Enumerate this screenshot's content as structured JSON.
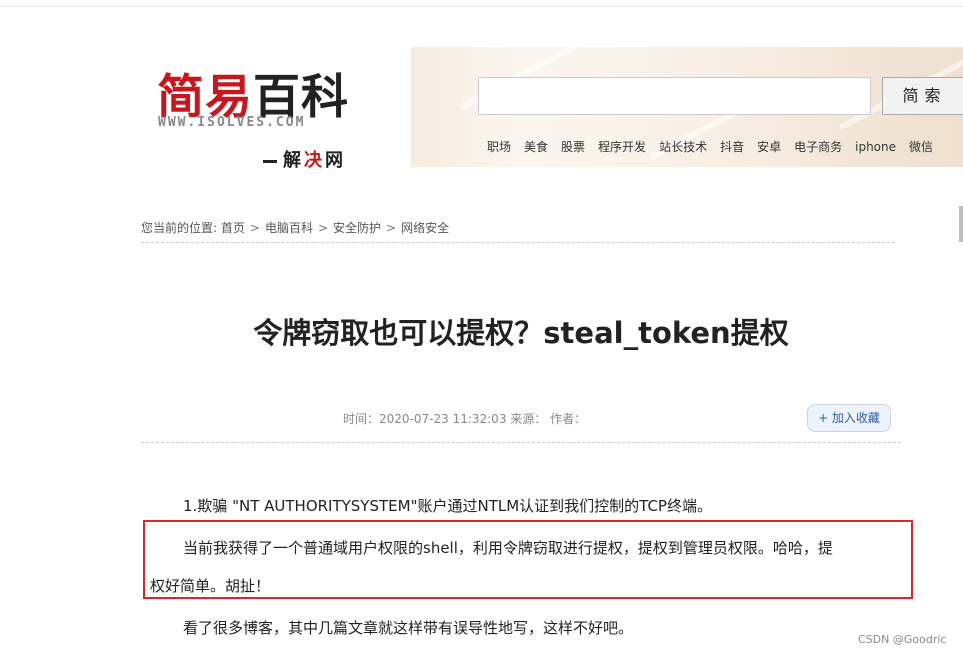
{
  "logo": {
    "title_red": "简易",
    "title_black": "百科",
    "url": "WWW.ISOLVES.COM",
    "slogan_a": "解",
    "slogan_b": "决",
    "slogan_c": "网"
  },
  "search": {
    "value": "",
    "placeholder": "",
    "button_label": "简索"
  },
  "hot_links": [
    "职场",
    "美食",
    "股票",
    "程序开发",
    "站长技术",
    "抖音",
    "安卓",
    "电子商务",
    "iphone",
    "微信"
  ],
  "breadcrumb": {
    "prefix": "您当前的位置:",
    "items": [
      "首页",
      "电脑百科",
      "安全防护",
      "网络安全"
    ],
    "separator": ">"
  },
  "article": {
    "title": "令牌窃取也可以提权？steal_token提权",
    "meta": "时间：2020-07-23 11:32:03  来源：  作者：",
    "favorite_label": "+ 加入收藏",
    "paragraphs": [
      "1.欺骗 \"NT AUTHORITYSYSTEM\"账户通过NTLM认证到我们控制的TCP终端。",
      "当前我获得了一个普通域用户权限的shell，利用令牌窃取进行提权，提权到管理员权限。哈哈，提",
      "权好简单。胡扯！",
      "看了很多博客，其中几篇文章就这样带有误导性地写，这样不好吧。"
    ]
  },
  "watermark": "CSDN @Goodric",
  "colors": {
    "brand_red": "#c8161d",
    "highlight_border": "#e0242b",
    "link_blue": "#2a5db0"
  }
}
